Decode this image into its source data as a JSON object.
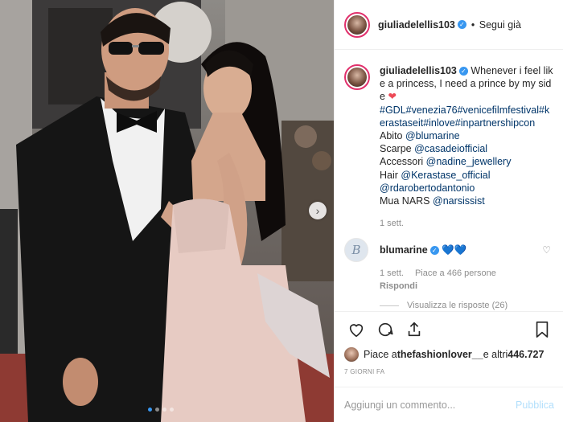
{
  "post": {
    "username": "giuliadelellis103",
    "follow_separator": "•",
    "follow_status": "Segui già",
    "verified_icon": "verified-badge-icon"
  },
  "caption": {
    "username": "giuliadelellis103",
    "text": " Whenever i feel like a princess, I need a prince by my side",
    "hashtags": "#GDL#venezia76#venicefilmfestival#kerastaseit#inlove#inpartnershipcon",
    "lines": [
      {
        "label": "Abito ",
        "handle": "@blumarine"
      },
      {
        "label": "Scarpe ",
        "handle": "@casadeiofficial"
      },
      {
        "label": "Accessori ",
        "handle": "@nadine_jewellery"
      },
      {
        "label": "Hair ",
        "handle": "@Kerastase_official"
      },
      {
        "label": "",
        "handle": "@rdarobertodantonio"
      },
      {
        "label": "Mua NARS ",
        "handle": "@narsissist"
      }
    ],
    "time": "1 sett."
  },
  "comment": {
    "avatar_letter": "B",
    "username": "blumarine",
    "text": "💙💙",
    "time": "1 sett.",
    "likes": "Piace a 466 persone",
    "reply": "Rispondi",
    "view_replies": "Visualizza le risposte (26)"
  },
  "likes": {
    "prefix": "Piace a ",
    "user": "thefashionlover__",
    "suffix": " e altri ",
    "count": "446.727"
  },
  "post_age": "7 GIORNI FA",
  "add_comment": {
    "placeholder": "Aggiungi un commento...",
    "publish": "Pubblica"
  },
  "colors": {
    "link": "#003569",
    "accent": "#3897f0",
    "muted": "#8e8e8e",
    "publish_disabled": "#b2dffc"
  }
}
